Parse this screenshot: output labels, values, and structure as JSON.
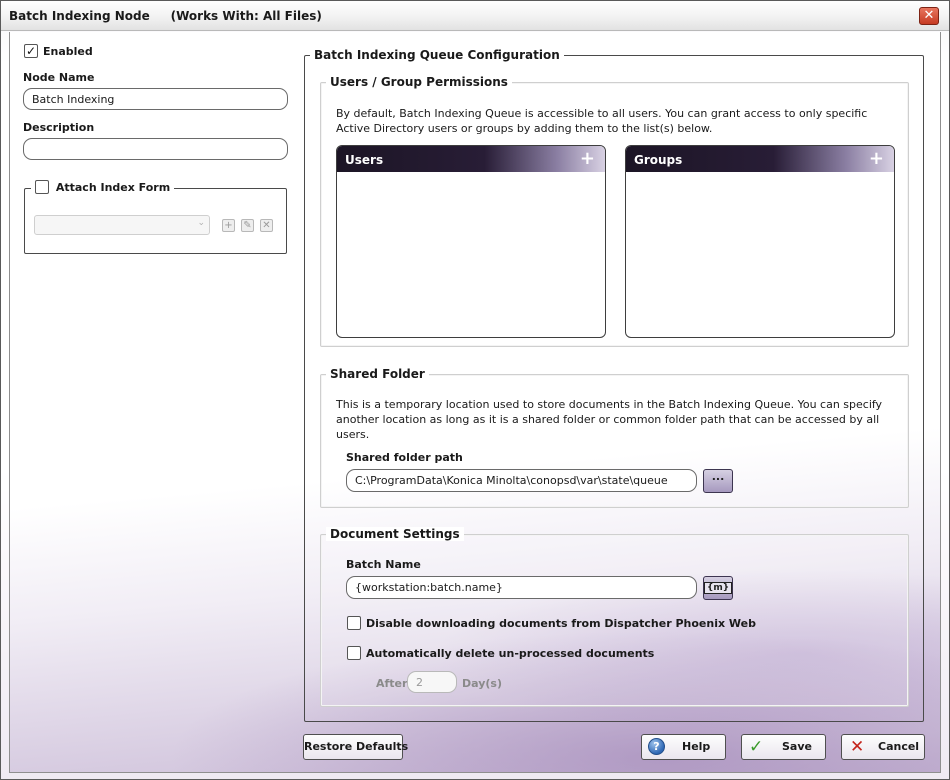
{
  "window": {
    "title": "Batch Indexing Node     (Works With: All Files)",
    "close": "✕"
  },
  "left": {
    "enabled_label": "Enabled",
    "enabled_checked": true,
    "node_name_label": "Node Name",
    "node_name_value": "Batch Indexing",
    "description_label": "Description",
    "description_value": "",
    "attach_form_label": "Attach Index Form",
    "attach_form_checked": false
  },
  "queue_config": {
    "title": "Batch Indexing Queue Configuration",
    "permissions": {
      "title": "Users / Group Permissions",
      "description": "By default, Batch Indexing Queue is accessible to all users. You can grant access to only specific Active Directory users or groups by adding them to the list(s) below.",
      "users_header": "Users",
      "groups_header": "Groups",
      "add_icon": "+"
    },
    "shared_folder": {
      "title": "Shared Folder",
      "description": "This is a temporary location used to store documents in the Batch Indexing Queue. You can specify another location as long as it is a shared folder or common folder path that can be accessed by all users.",
      "path_label": "Shared folder path",
      "path_value": "C:\\ProgramData\\Konica Minolta\\conopsd\\var\\state\\queue",
      "browse_label": "..."
    },
    "document_settings": {
      "title": "Document Settings",
      "batch_name_label": "Batch Name",
      "batch_name_value": "{workstation:batch.name}",
      "disable_download_label": "Disable downloading documents from Dispatcher Phoenix Web",
      "disable_download_checked": false,
      "auto_delete_label": "Automatically delete un-processed documents",
      "auto_delete_checked": false,
      "after_label": "After",
      "after_value": "2",
      "days_label": "Day(s)"
    }
  },
  "footer": {
    "restore_label": "Restore Defaults",
    "help_label": "Help",
    "save_label": "Save",
    "cancel_label": "Cancel"
  },
  "colors": {
    "accent_purple": "#2a1f3a",
    "save_check": "#3a9a2a",
    "cancel_x": "#c4231b"
  }
}
